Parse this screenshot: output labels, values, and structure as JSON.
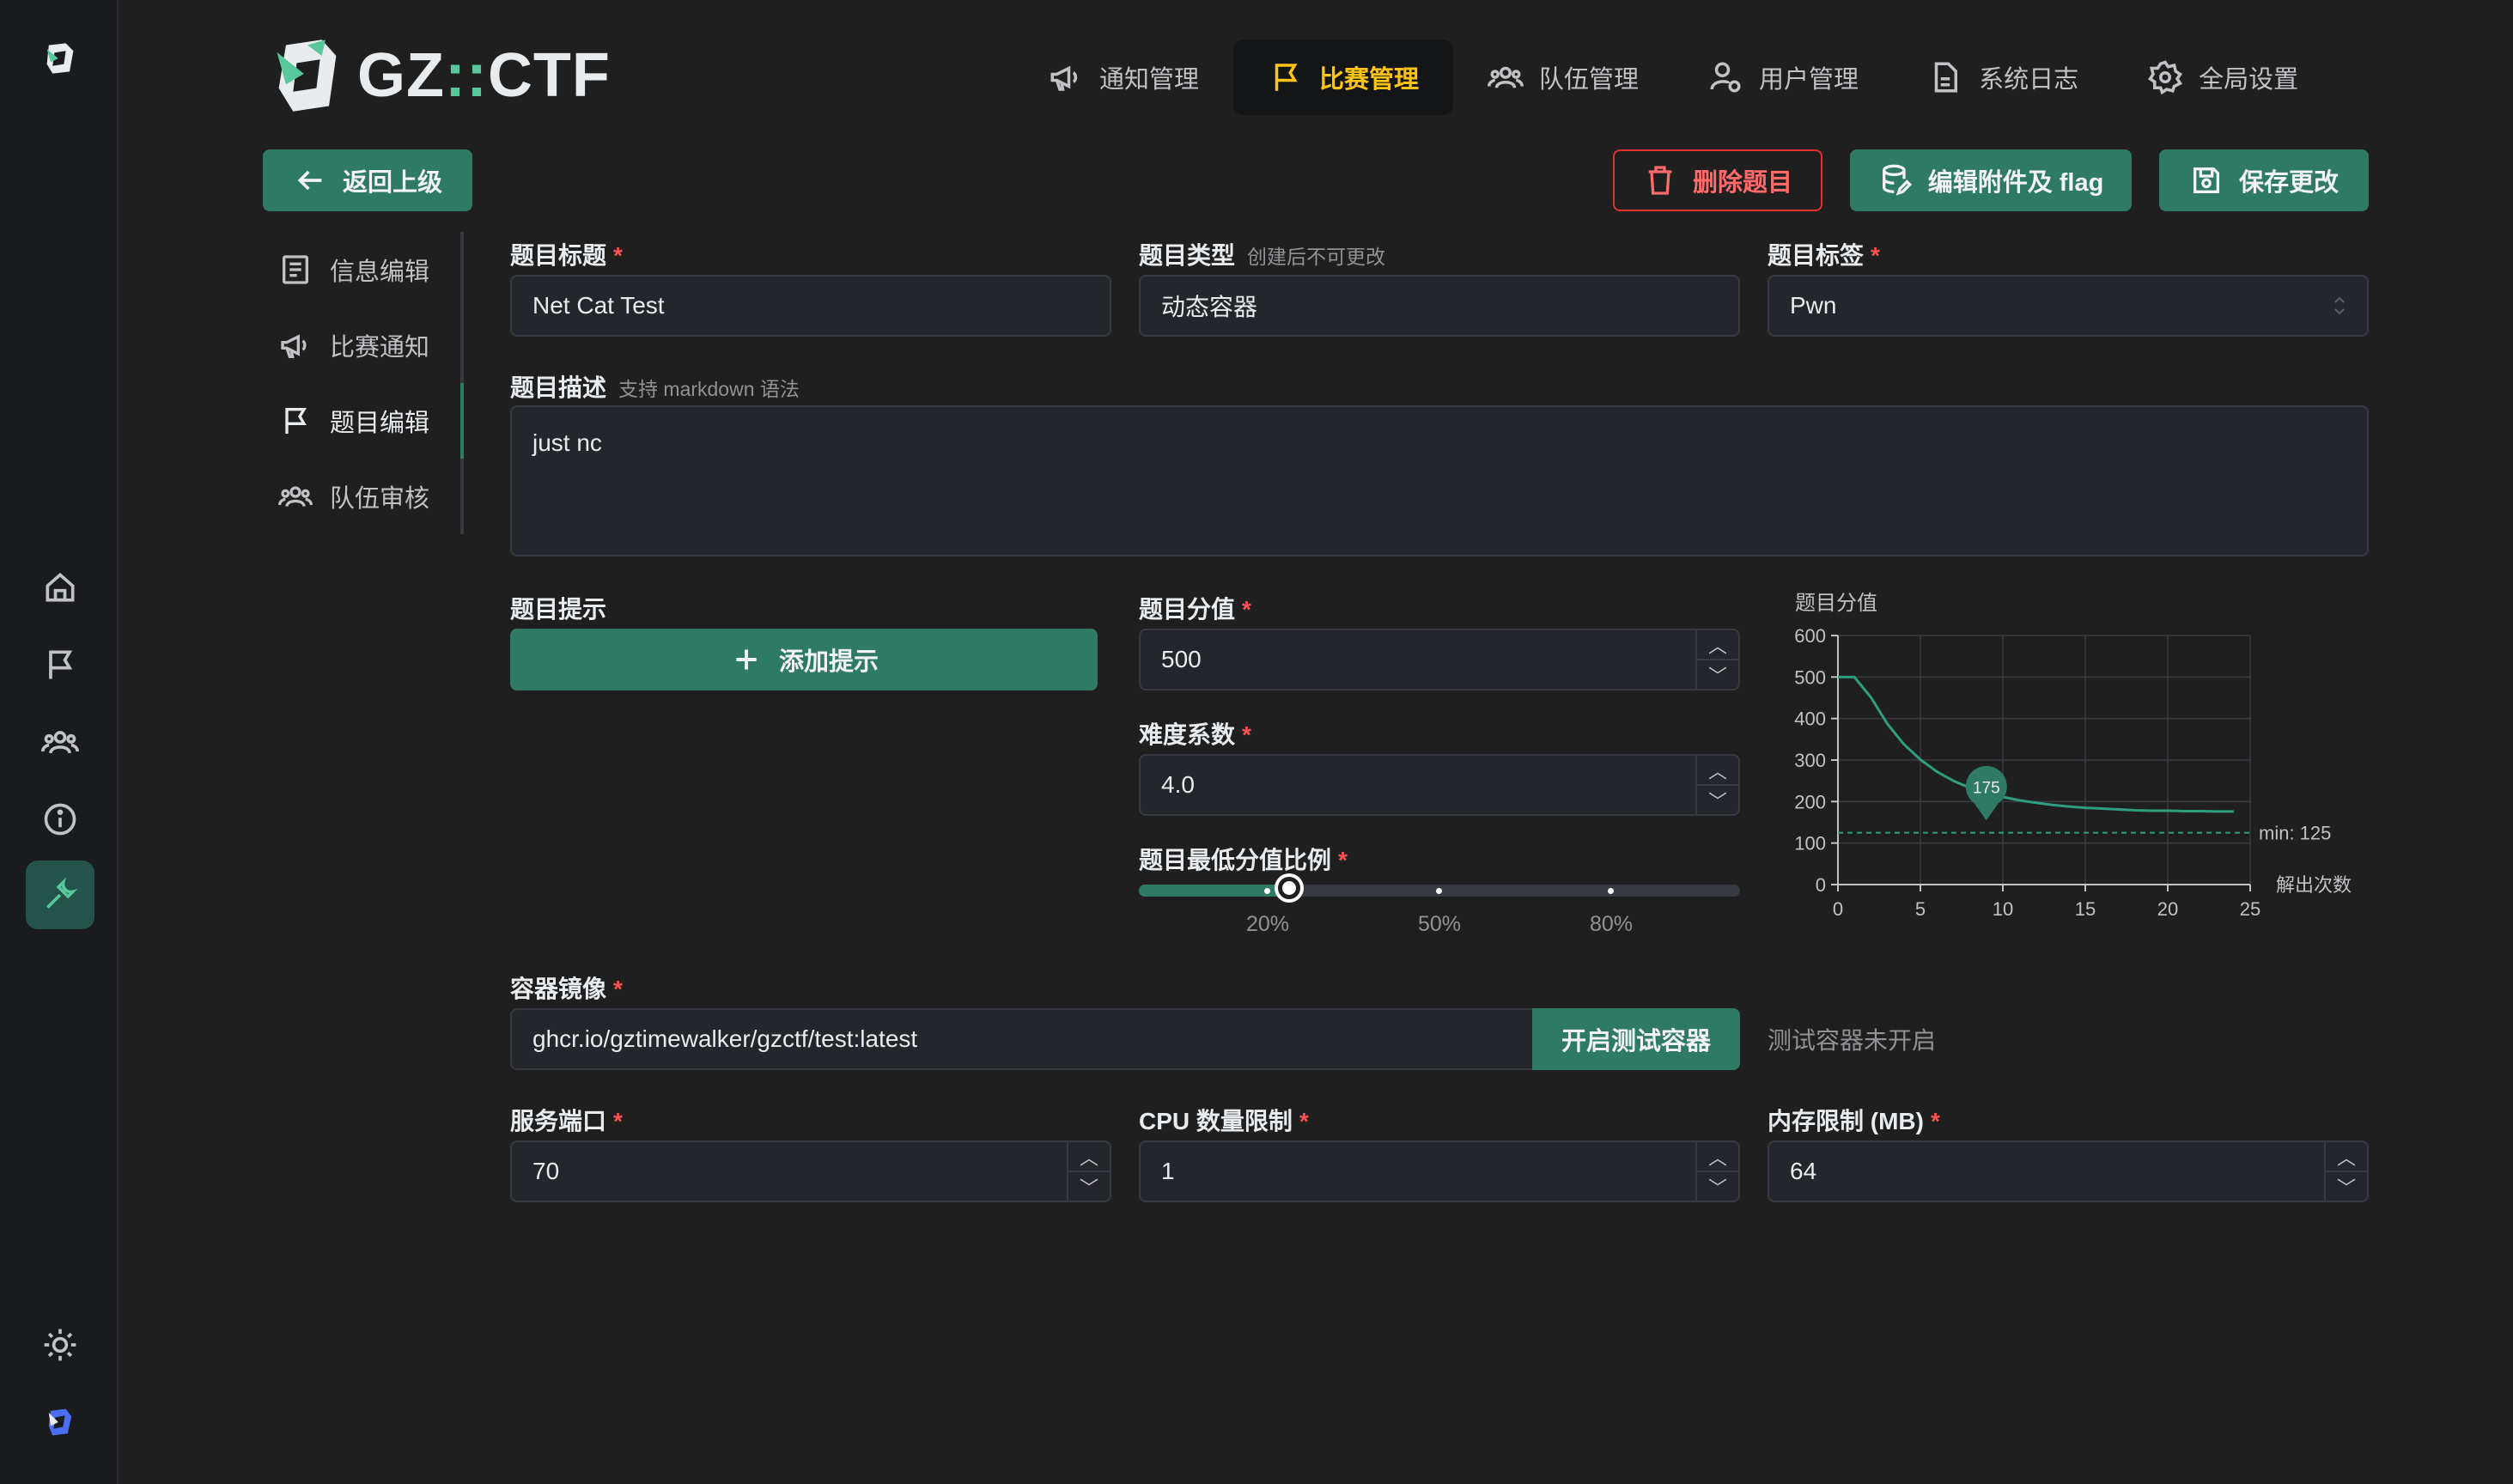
{
  "brand": {
    "text_main": "GZ",
    "text_sep": "::",
    "text_end": "CTF"
  },
  "topnav": [
    {
      "label": "通知管理",
      "icon": "megaphone-icon"
    },
    {
      "label": "比赛管理",
      "icon": "flag-icon",
      "active": true
    },
    {
      "label": "队伍管理",
      "icon": "users-icon"
    },
    {
      "label": "用户管理",
      "icon": "user-cog-icon"
    },
    {
      "label": "系统日志",
      "icon": "file-icon"
    },
    {
      "label": "全局设置",
      "icon": "gear-icon"
    }
  ],
  "actions": {
    "back": "返回上级",
    "delete": "删除题目",
    "edit_attachments": "编辑附件及 flag",
    "save": "保存更改"
  },
  "subnav": [
    {
      "label": "信息编辑",
      "icon": "document-icon"
    },
    {
      "label": "比赛通知",
      "icon": "megaphone-icon"
    },
    {
      "label": "题目编辑",
      "icon": "flag-icon",
      "active": true
    },
    {
      "label": "队伍审核",
      "icon": "users-icon"
    }
  ],
  "form": {
    "title_label": "题目标题",
    "title_value": "Net Cat Test",
    "type_label": "题目类型",
    "type_hint": "创建后不可更改",
    "type_value": "动态容器",
    "tag_label": "题目标签",
    "tag_value": "Pwn",
    "desc_label": "题目描述",
    "desc_hint": "支持 markdown 语法",
    "desc_value": "just nc",
    "hints_label": "题目提示",
    "add_hint": "添加提示",
    "score_label": "题目分值",
    "score_value": "500",
    "difficulty_label": "难度系数",
    "difficulty_value": "4.0",
    "min_ratio_label": "题目最低分值比例",
    "min_ratio_value": 0.25,
    "min_ratio_marks": [
      "20%",
      "50%",
      "80%"
    ],
    "image_label": "容器镜像",
    "image_value": "ghcr.io/gztimewalker/gzctf/test:latest",
    "start_test": "开启测试容器",
    "test_status": "测试容器未开启",
    "port_label": "服务端口",
    "port_value": "70",
    "cpu_label": "CPU 数量限制",
    "cpu_value": "1",
    "mem_label": "内存限制 (MB)",
    "mem_value": "64",
    "required_mark": "*"
  },
  "chart_data": {
    "type": "line",
    "title": "题目分值",
    "xlabel": "解出次数",
    "x_ticks": [
      "0",
      "5",
      "10",
      "15",
      "20",
      "25"
    ],
    "y_ticks": [
      "0",
      "100",
      "200",
      "300",
      "400",
      "500",
      "600"
    ],
    "xlim": [
      0,
      25
    ],
    "ylim": [
      0,
      600
    ],
    "series": [
      {
        "x": [
          0,
          1,
          2,
          3,
          4,
          5,
          6,
          7,
          8,
          9,
          10,
          11,
          12,
          13,
          14,
          15,
          16,
          17,
          18,
          19,
          20,
          21,
          22,
          23,
          24
        ],
        "y": [
          500,
          500,
          451,
          387,
          338,
          301,
          272,
          250,
          233,
          221,
          211,
          203,
          197,
          192,
          188,
          185,
          183,
          181,
          179,
          178,
          178,
          177,
          177,
          176,
          176
        ]
      }
    ],
    "marker": {
      "x": 9,
      "y": 175,
      "label": "175"
    },
    "min_line": {
      "y": 125,
      "label": "min: 125"
    },
    "colors": {
      "line": "#2f9e7e",
      "accent": "#2f7a64"
    }
  }
}
